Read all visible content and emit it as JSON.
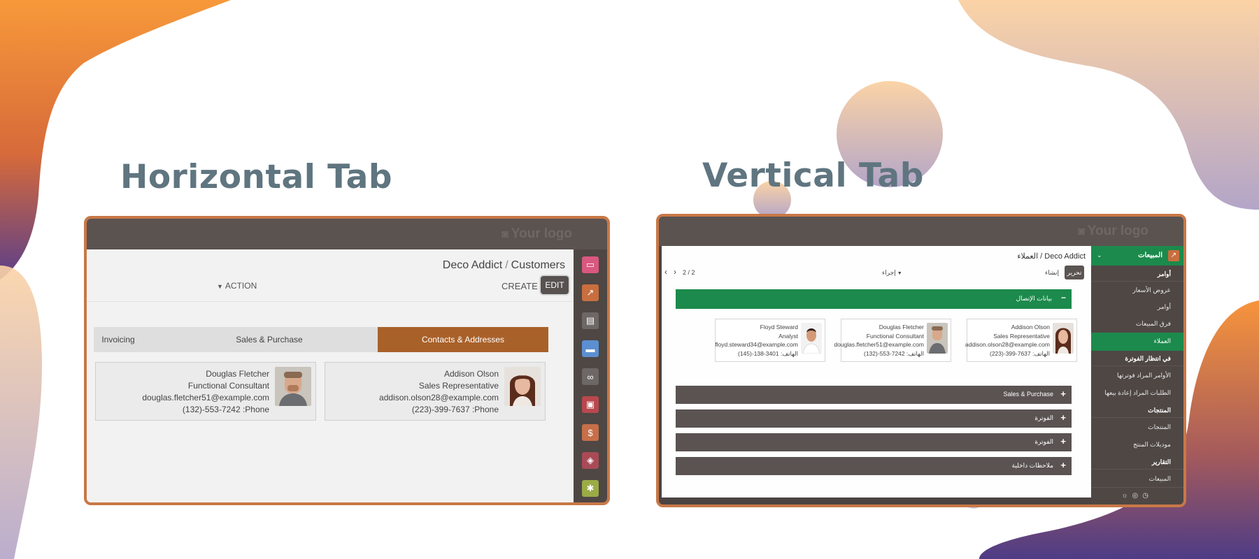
{
  "titles": {
    "horizontal": "Horizontal Tab",
    "vertical": "Vertical Tab"
  },
  "colors": {
    "accent_orange": "#a9612a",
    "border_orange": "#c87847",
    "green": "#1c8a4c",
    "topbar": "#5b5350",
    "title_gray": "#5f7580"
  },
  "left": {
    "logo": "Your logo",
    "breadcrumb": {
      "parent": "Deco Addict",
      "sep": "/",
      "current": "Customers"
    },
    "action_label": "ACTION",
    "create_label": "CREATE",
    "edit_label": "EDIT",
    "tabs": [
      {
        "label": "Invoicing"
      },
      {
        "label": "Sales & Purchase"
      },
      {
        "label": "Contacts & Addresses"
      }
    ],
    "contacts": [
      {
        "name": "Douglas Fletcher",
        "title": "Functional Consultant",
        "email": "douglas.fletcher51@example.com",
        "phone": "(132)-553-7242 :Phone"
      },
      {
        "name": "Addison Olson",
        "title": "Sales Representative",
        "email": "addison.olson28@example.com",
        "phone": "(223)-399-7637 :Phone"
      }
    ],
    "sidebar_icons": [
      "chat-icon",
      "chart-icon",
      "store-icon",
      "card-icon",
      "link-icon",
      "box-icon",
      "invoice-icon",
      "cubes-icon",
      "gear-icon"
    ]
  },
  "right": {
    "logo": "Your logo",
    "breadcrumb": "العملاء / Deco Addict",
    "edit_label": "تحرير",
    "create_label": "إنشاء",
    "action_label": "إجراء",
    "pager": "2 / 2",
    "section_label": "بيانات الإتصال",
    "contacts": [
      {
        "name": "Addison Olson",
        "title": "Sales Representative",
        "email": "addison.olson28@example.com",
        "phone": "الهاتف: 7637-399-(223)"
      },
      {
        "name": "Douglas Fletcher",
        "title": "Functional Consultant",
        "email": "douglas.fletcher51@example.com",
        "phone": "الهاتف: 7242-553-(132)"
      },
      {
        "name": "Floyd Steward",
        "title": "Analyst",
        "email": "floyd.steward34@example.com",
        "phone": "الهاتف: 3401-138-(145)"
      }
    ],
    "collapsed_sections": [
      "Sales & Purchase",
      "الفوترة",
      "الفوترة",
      "ملاحظات داخلية"
    ],
    "sidebar": {
      "app": "المبيعات",
      "items": [
        {
          "label": "أوامر",
          "header": true
        },
        {
          "label": "عروض الأسعار",
          "header": false
        },
        {
          "label": "أوامر",
          "header": false
        },
        {
          "label": "فرق المبيعات",
          "header": false
        },
        {
          "label": "العملاء",
          "header": false,
          "active": true
        },
        {
          "label": "في انتظار الفوترة",
          "header": true
        },
        {
          "label": "الأوامر المراد فوترتها",
          "header": false
        },
        {
          "label": "الطلبات المراد إعادة بيعها",
          "header": false
        },
        {
          "label": "المنتجات",
          "header": true
        },
        {
          "label": "المنتجات",
          "header": false
        },
        {
          "label": "موديلات المنتج",
          "header": false
        },
        {
          "label": "التقارير",
          "header": true
        },
        {
          "label": "المبيعات",
          "header": false
        }
      ]
    }
  }
}
